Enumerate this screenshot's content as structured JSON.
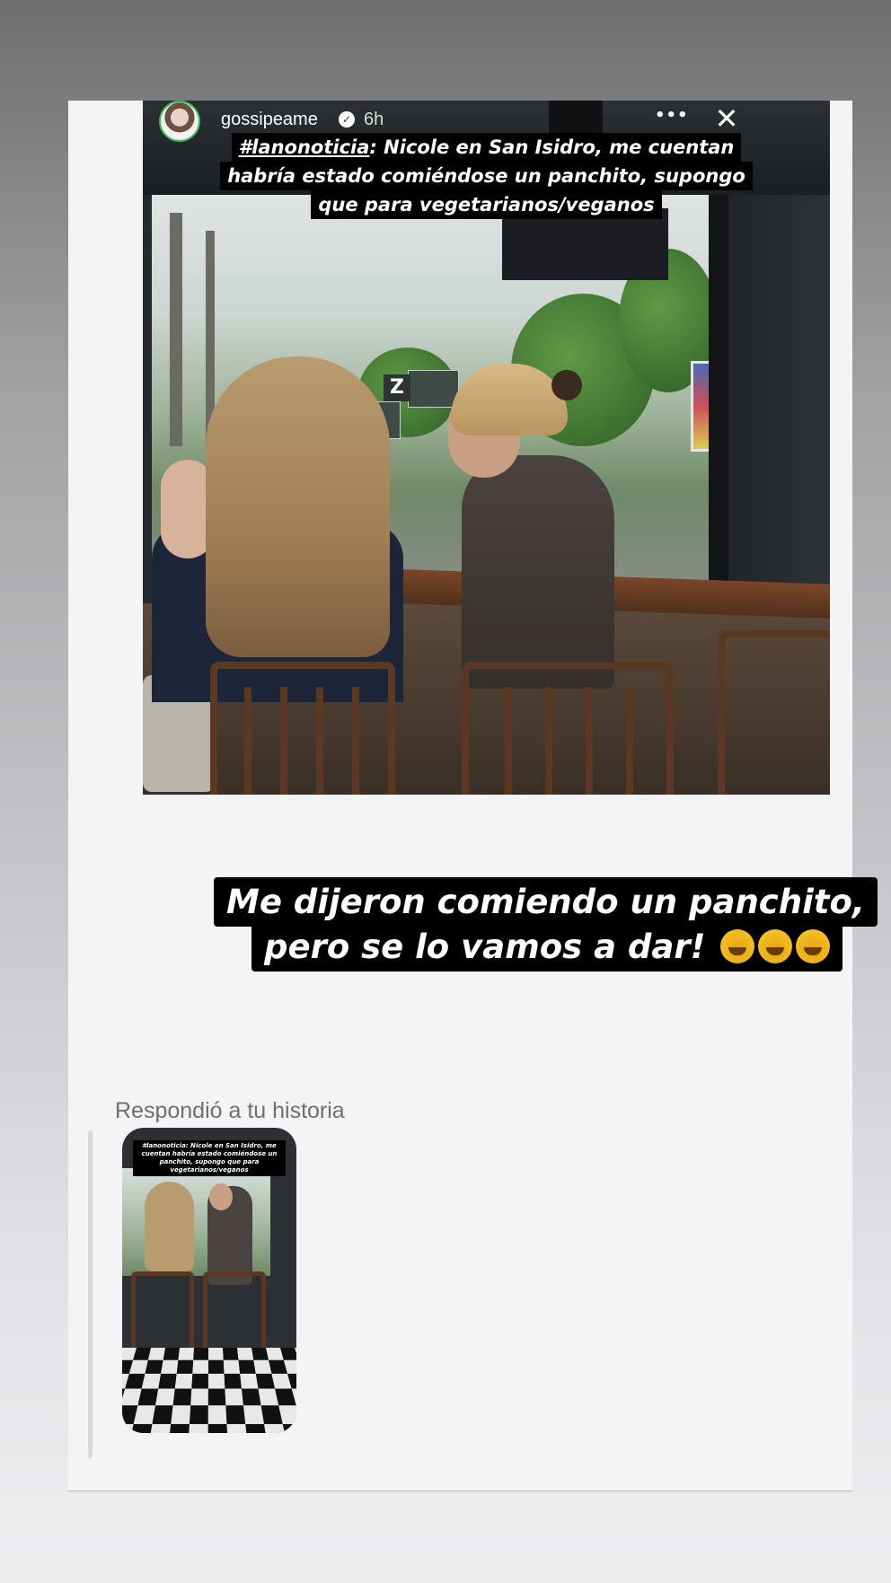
{
  "story": {
    "username": "gossipeame",
    "time": "6h",
    "caption_tag": "#lanonoticia",
    "caption_lines": [
      ": Nicole en San Isidro, me cuentan",
      "habría estado comiéndose un panchito, supongo",
      "que para vegetarianos/veganos"
    ],
    "more_icon": "more-horizontal-icon",
    "close_icon": "close-icon"
  },
  "reply": {
    "line1": "Me dijeron comiendo un panchito,",
    "line2": "pero se lo vamos a dar!",
    "emojis": [
      "rolling-on-floor-laughing",
      "tears-of-joy",
      "rolling-on-floor-laughing"
    ]
  },
  "replied_label": "Respondió a tu historia",
  "thumbnail": {
    "caption": "#lanonoticia: Nicole en San Isidro, me cuentan habría estado comiéndose un panchito, supongo que para vegetarianos/veganos"
  },
  "colors": {
    "caption_bg": "#000000",
    "caption_text": "#ffffff",
    "label_text": "#6f6f73",
    "card_bg": "#f4f4f7"
  }
}
